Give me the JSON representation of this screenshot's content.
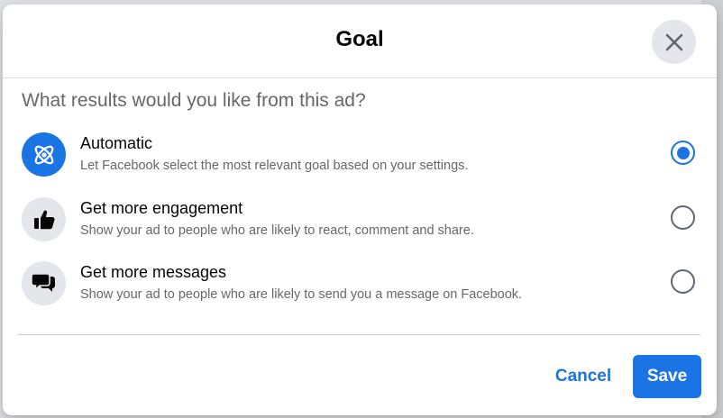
{
  "dialog": {
    "title": "Goal",
    "question": "What results would you like from this ad?",
    "close_icon": "close-icon"
  },
  "options": [
    {
      "title": "Automatic",
      "description": "Let Facebook select the most relevant goal based on your settings.",
      "icon": "atom-icon",
      "selected": true
    },
    {
      "title": "Get more engagement",
      "description": "Show your ad to people who are likely to react, comment and share.",
      "icon": "thumbs-up-icon",
      "selected": false
    },
    {
      "title": "Get more messages",
      "description": "Show your ad to people who are likely to send you a message on Facebook.",
      "icon": "chat-bubbles-icon",
      "selected": false
    }
  ],
  "footer": {
    "cancel_label": "Cancel",
    "save_label": "Save"
  },
  "colors": {
    "accent": "#1b74e4",
    "text_primary": "#050505",
    "text_secondary": "#65676b"
  }
}
